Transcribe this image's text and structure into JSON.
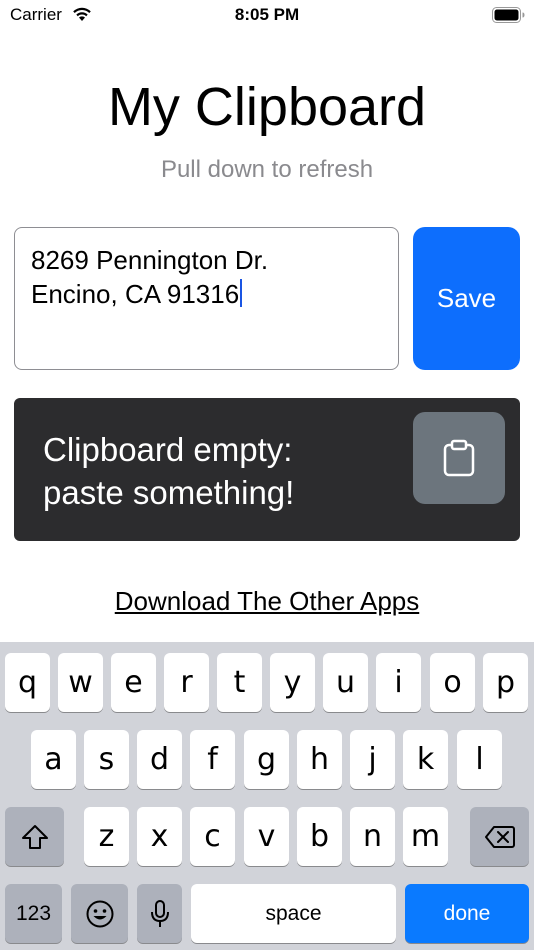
{
  "status_bar": {
    "carrier": "Carrier",
    "time": "8:05 PM"
  },
  "header": {
    "title": "My Clipboard",
    "subtitle": "Pull down to refresh"
  },
  "input": {
    "line1": "8269 Pennington Dr.",
    "line2": "Encino, CA 91316"
  },
  "save_button": {
    "label": "Save"
  },
  "clipboard": {
    "line1": "Clipboard empty:",
    "line2": "paste something!"
  },
  "download_link": {
    "label": "Download The Other Apps"
  },
  "keyboard": {
    "row1": [
      "q",
      "w",
      "e",
      "r",
      "t",
      "y",
      "u",
      "i",
      "o",
      "p"
    ],
    "row2": [
      "a",
      "s",
      "d",
      "f",
      "g",
      "h",
      "j",
      "k",
      "l"
    ],
    "row3": [
      "z",
      "x",
      "c",
      "v",
      "b",
      "n",
      "m"
    ],
    "numbers_label": "123",
    "space_label": "space",
    "done_label": "done"
  },
  "colors": {
    "accent": "#0d6efd",
    "card": "#2c2c2e",
    "paste_button": "#6c757d",
    "keyboard_bg": "#d1d3d9",
    "done": "#0a7aff"
  },
  "icons": [
    "wifi-icon",
    "battery-icon",
    "clipboard-icon",
    "shift-icon",
    "backspace-icon",
    "emoji-icon",
    "microphone-icon"
  ]
}
